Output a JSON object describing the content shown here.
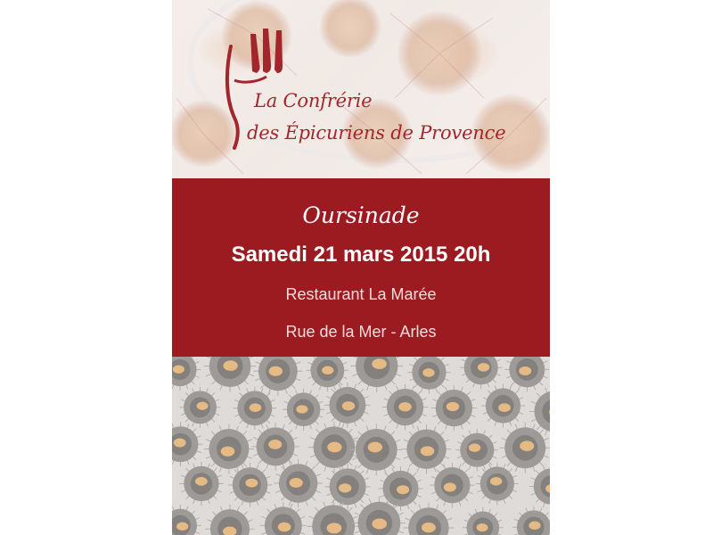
{
  "logo": {
    "line1": "La Confrérie",
    "line2": "des Épicuriens de Provence",
    "icon": "fork-icon",
    "color": "#a3262d"
  },
  "event": {
    "title": "Oursinade",
    "date": "Samedi 21 mars 2015 20h",
    "venue": "Restaurant La Marée",
    "address": "Rue de la Mer - Arles"
  },
  "colors": {
    "banner": "#9b1b20",
    "text": "#ffffff"
  }
}
